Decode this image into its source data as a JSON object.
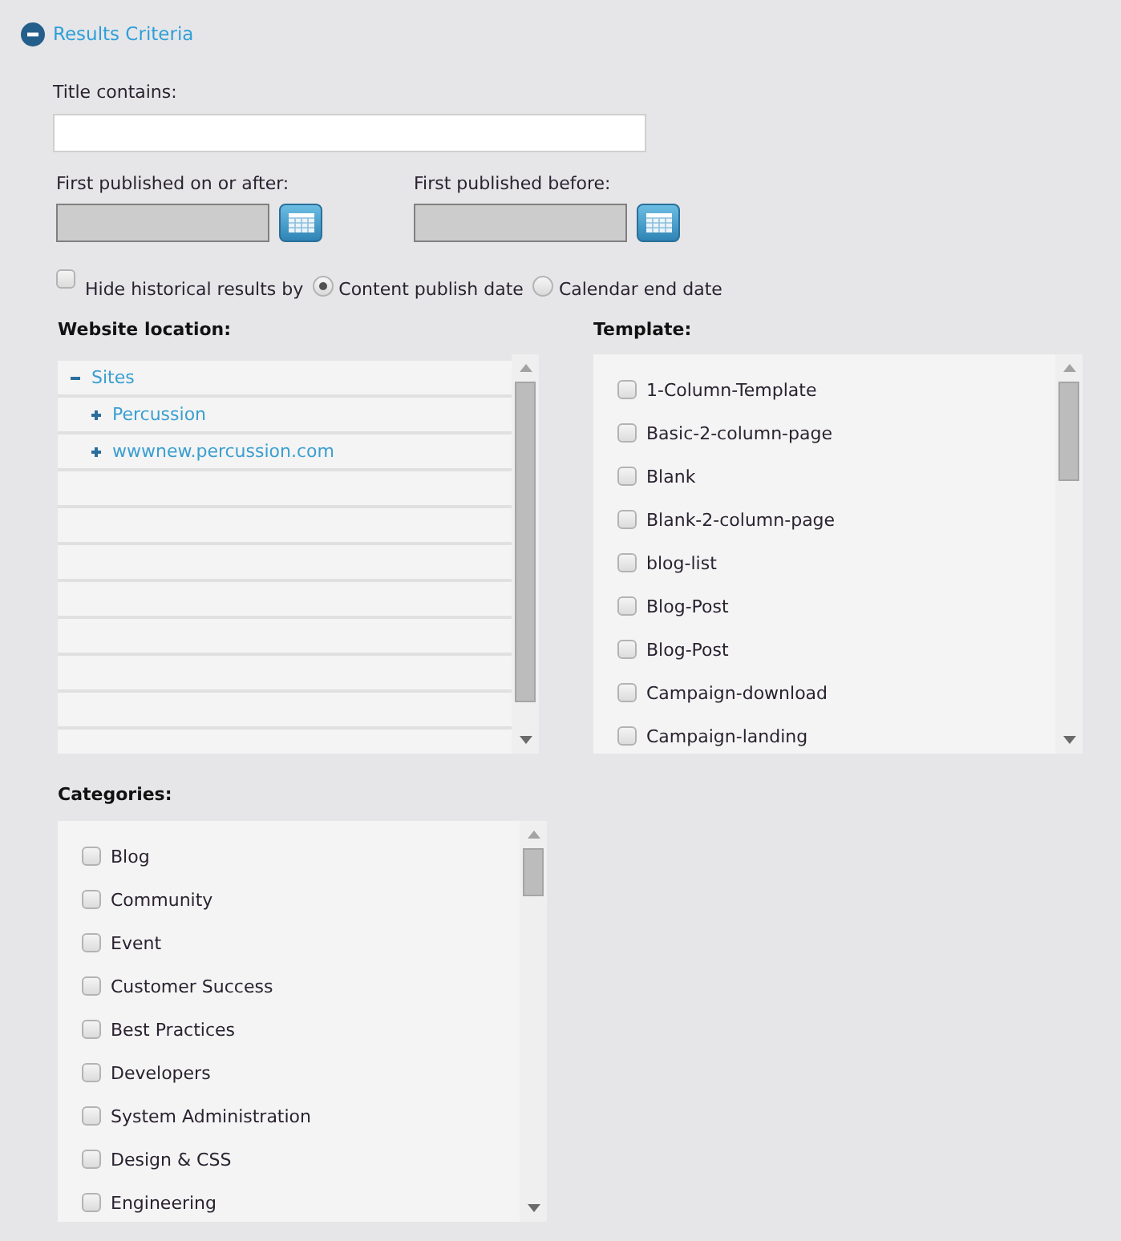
{
  "section": {
    "title": "Results Criteria",
    "expanded": true
  },
  "title_filter": {
    "label": "Title contains:"
  },
  "date_filters": [
    {
      "label": "First published on or after:"
    },
    {
      "label": "First published before:"
    }
  ],
  "hide_historical": {
    "label": "Hide historical results by",
    "checked": false,
    "options": [
      {
        "label": "Content publish date",
        "selected": true
      },
      {
        "label": "Calendar end date",
        "selected": false
      }
    ]
  },
  "website_location": {
    "label": "Website location:",
    "tree": [
      {
        "label": "Sites",
        "expanded": true,
        "children": [
          {
            "label": "Percussion",
            "expanded": false
          },
          {
            "label": "wwwnew.percussion.com",
            "expanded": false
          }
        ]
      }
    ]
  },
  "template": {
    "label": "Template:",
    "options": [
      {
        "label": "1-Column-Template",
        "checked": false
      },
      {
        "label": "Basic-2-column-page",
        "checked": false
      },
      {
        "label": "Blank",
        "checked": false
      },
      {
        "label": "Blank-2-column-page",
        "checked": false
      },
      {
        "label": "blog-list",
        "checked": false
      },
      {
        "label": "Blog-Post",
        "checked": false
      },
      {
        "label": "Blog-Post",
        "checked": false
      },
      {
        "label": "Campaign-download",
        "checked": false
      },
      {
        "label": "Campaign-landing",
        "checked": false
      }
    ]
  },
  "categories": {
    "label": "Categories:",
    "options": [
      {
        "label": "Blog",
        "checked": false
      },
      {
        "label": "Community",
        "checked": false
      },
      {
        "label": "Event",
        "checked": false
      },
      {
        "label": "Customer Success",
        "checked": false
      },
      {
        "label": "Best Practices",
        "checked": false
      },
      {
        "label": "Developers",
        "checked": false
      },
      {
        "label": "System Administration",
        "checked": false
      },
      {
        "label": "Design & CSS",
        "checked": false
      },
      {
        "label": "Engineering",
        "checked": false
      }
    ]
  }
}
